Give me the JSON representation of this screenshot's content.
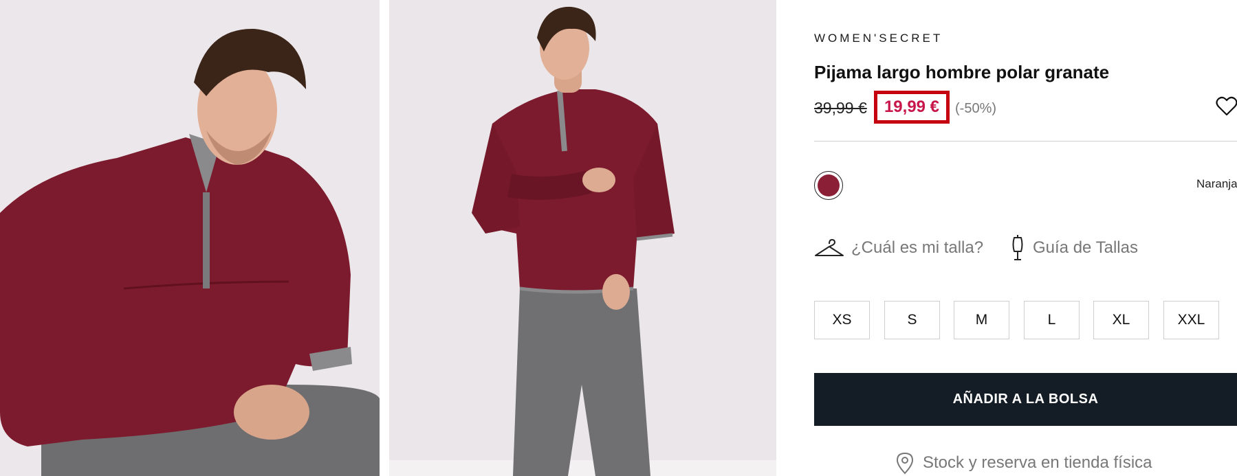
{
  "product": {
    "brand": "WOMEN'SECRET",
    "title": "Pijama largo hombre polar granate",
    "old_price": "39,99 €",
    "price": "19,99 €",
    "discount": "(-50%)",
    "color_name": "Naranja",
    "swatch_color": "#8a1f36",
    "price_color": "#c8164a",
    "highlight_color": "#c5000f"
  },
  "size_help": {
    "fit_label": "¿Cuál es mi talla?",
    "guide_label": "Guía de Tallas"
  },
  "sizes": [
    "XS",
    "S",
    "M",
    "L",
    "XL",
    "XXL"
  ],
  "actions": {
    "add_to_bag": "AÑADIR A LA BOLSA",
    "store_stock": "Stock y reserva en tienda física"
  },
  "icons": {
    "wishlist": "heart-icon",
    "fit": "hanger-icon",
    "guide": "mannequin-icon",
    "stock": "location-pin-icon"
  }
}
